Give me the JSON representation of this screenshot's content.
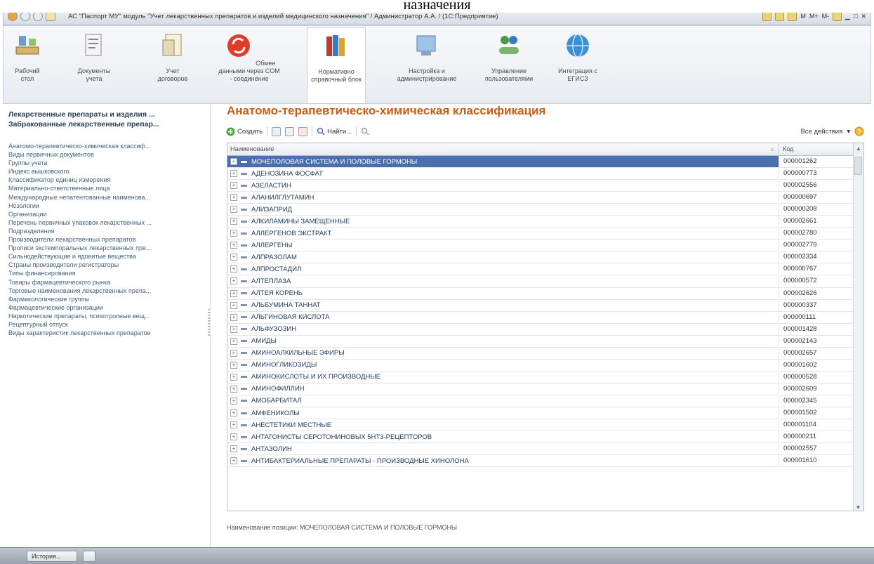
{
  "caption": "назначения",
  "window": {
    "title": "АС \"Паспорт МУ\" модуль \"Учет лекарственных препаратов и изделий медицинского назначения\" / Администратор А.А. / (1С:Предприятие)",
    "right_labels": [
      "M",
      "M+",
      "M-"
    ]
  },
  "sections": [
    {
      "label": "Рабочий стол",
      "icon": "desktop-icon",
      "active": false
    },
    {
      "label": "Документы учета",
      "icon": "documents-icon",
      "active": false
    },
    {
      "label": "Учет договоров",
      "icon": "contracts-icon",
      "active": false
    },
    {
      "label": "Обмен данными через COM - соединение",
      "icon": "exchange-icon",
      "active": false
    },
    {
      "label": "Нормативно справочный блок",
      "icon": "reference-books-icon",
      "active": true
    },
    {
      "label": "Настройка и администрирование",
      "icon": "settings-admin-icon",
      "active": false
    },
    {
      "label": "Управление пользователями",
      "icon": "users-icon",
      "active": false
    },
    {
      "label": "Интеграция с ЕГИСЗ",
      "icon": "globe-icon",
      "active": false
    }
  ],
  "sidebar": {
    "headings": [
      "Лекарственные препараты и изделия ...",
      "Забракованные лекарственные препар..."
    ],
    "items": [
      "Анатомо-терапевтическо-химическая классиф...",
      "Виды первичных документов",
      "Группы учета",
      "Индекс вышковского",
      "Классификатор единиц измерения",
      "Материально-ответственные лица",
      "Международные непатентованные наименова...",
      "Нозологии",
      "Организации",
      "Перечень первичных упаковок лекарственных ...",
      "Подразделения",
      "Производители лекарственных препаратов",
      "Прописи экстемпоральных лекарственных пре...",
      "Сильнодействующие и ядовитые вещества",
      "Страны производители регистраторы",
      "Типы финансирования",
      "Товары фармацевтического рынка",
      "Торговые наименования лекарственных препа...",
      "Фармакологические группы",
      "Фармацевтические организации",
      "Наркотические препараты, психотропные вещ...",
      "Рецептурный отпуск",
      "Виды характеристик лекарственных препаратов"
    ]
  },
  "main": {
    "title": "Анатомо-терапевтическо-химическая классификация",
    "toolbar": {
      "create": "Создать",
      "find": "Найти..."
    },
    "all_actions": "Все действия",
    "columns": {
      "name": "Наименование",
      "code": "Код"
    },
    "rows": [
      {
        "name": "МОЧЕПОЛОВАЯ СИСТЕМА И ПОЛОВЫЕ ГОРМОНЫ",
        "code": "000001262",
        "selected": true
      },
      {
        "name": "АДЕНОЗИНА ФОСФАТ",
        "code": "000000773"
      },
      {
        "name": "АЗЕЛАСТИН",
        "code": "000002556"
      },
      {
        "name": "АЛАНИЛГЛУТАМИН",
        "code": "000000697"
      },
      {
        "name": "АЛИЗАПРИД",
        "code": "000000208"
      },
      {
        "name": "АЛКИЛАМИНЫ ЗАМЕЩЕННЫЕ",
        "code": "000002661"
      },
      {
        "name": "АЛЛЕРГЕНОВ ЭКСТРАКТ",
        "code": "000002780"
      },
      {
        "name": "АЛЛЕРГЕНЫ",
        "code": "000002779"
      },
      {
        "name": "АЛПРАЗОЛАМ",
        "code": "000002334"
      },
      {
        "name": "АЛПРОСТАДИЛ",
        "code": "000000767"
      },
      {
        "name": "АЛТЕПЛАЗА",
        "code": "000000572"
      },
      {
        "name": "АЛТЕЯ КОРЕНЬ",
        "code": "000002626"
      },
      {
        "name": "АЛЬБУМИНА ТАННАТ",
        "code": "000000337"
      },
      {
        "name": "АЛЬГИНОВАЯ КИСЛОТА",
        "code": "000000111"
      },
      {
        "name": "АЛЬФУЗОЗИН",
        "code": "000001428"
      },
      {
        "name": "АМИДЫ",
        "code": "000002143"
      },
      {
        "name": "АМИНОАЛКИЛЬНЫЕ ЭФИРЫ",
        "code": "000002657"
      },
      {
        "name": "АМИНОГЛИКОЗИДЫ",
        "code": "000001602"
      },
      {
        "name": "АМИНОКИСЛОТЫ И ИХ ПРОИЗВОДНЫЕ",
        "code": "000000528"
      },
      {
        "name": "АМИНОФИЛЛИН",
        "code": "000002609"
      },
      {
        "name": "АМОБАРБИТАЛ",
        "code": "000002345"
      },
      {
        "name": "АМФЕНИКОЛЫ",
        "code": "000001502"
      },
      {
        "name": "АНЕСТЕТИКИ МЕСТНЫЕ",
        "code": "000001104"
      },
      {
        "name": "АНТАГОНИСТЫ СЕРОТОНИНОВЫХ 5НТ3-РЕЦЕПТОРОВ",
        "code": "000000211"
      },
      {
        "name": "АНТАЗОЛИН",
        "code": "000002557"
      },
      {
        "name": "АНТИБАКТЕРИАЛЬНЫЕ ПРЕПАРАТЫ - ПРОИЗВОДНЫЕ ХИНОЛОНА",
        "code": "000001610"
      }
    ],
    "status": "Наименование позиции: МОЧЕПОЛОВАЯ СИСТЕМА И ПОЛОВЫЕ ГОРМОНЫ"
  },
  "taskbar": {
    "history": "История..."
  }
}
